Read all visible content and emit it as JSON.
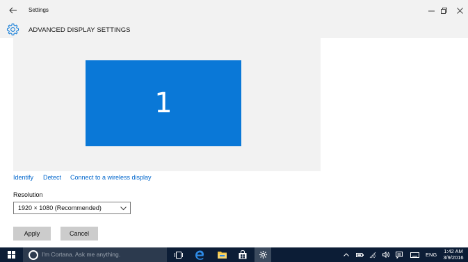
{
  "window": {
    "title": "Settings",
    "back_icon": "back-arrow-icon",
    "controls": [
      "minimize-icon",
      "maximize-icon",
      "close-icon"
    ]
  },
  "header": {
    "icon": "gear-icon",
    "title": "ADVANCED DISPLAY SETTINGS"
  },
  "display": {
    "monitor_number": "1",
    "tile_color": "#0a78d7"
  },
  "links": {
    "identify": "Identify",
    "detect": "Detect",
    "wireless": "Connect to a wireless display"
  },
  "resolution": {
    "label": "Resolution",
    "selected": "1920 × 1080 (Recommended)"
  },
  "buttons": {
    "apply": "Apply",
    "cancel": "Cancel"
  },
  "taskbar": {
    "search_placeholder": "I'm Cortana. Ask me anything.",
    "pinned": [
      "task-view-icon",
      "edge-icon",
      "file-explorer-icon",
      "store-icon",
      "settings-icon"
    ],
    "tray": [
      "chevron-up-icon",
      "battery-icon",
      "network-icon",
      "volume-icon",
      "action-center-icon",
      "keyboard-icon"
    ],
    "language": "ENG",
    "time": "1:42 AM",
    "date": "3/9/2016"
  },
  "colors": {
    "accent": "#0a78d7",
    "link": "#0066cc",
    "taskbar": "#0c1d36"
  }
}
